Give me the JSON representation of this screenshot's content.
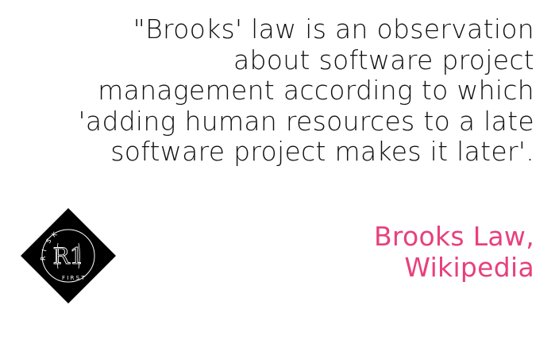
{
  "quote": {
    "lines": [
      "\"Brooks' law is an observation",
      "about software project",
      "management according to which",
      "'adding human resources to a late",
      "software project makes it later'."
    ]
  },
  "attribution": {
    "lines": [
      "Brooks Law,",
      "Wikipedia"
    ]
  },
  "logo": {
    "text_top": "RISK",
    "text_bottom": "FIRST",
    "monogram": "R1"
  },
  "colors": {
    "accent": "#e8407d",
    "text": "#111111"
  }
}
